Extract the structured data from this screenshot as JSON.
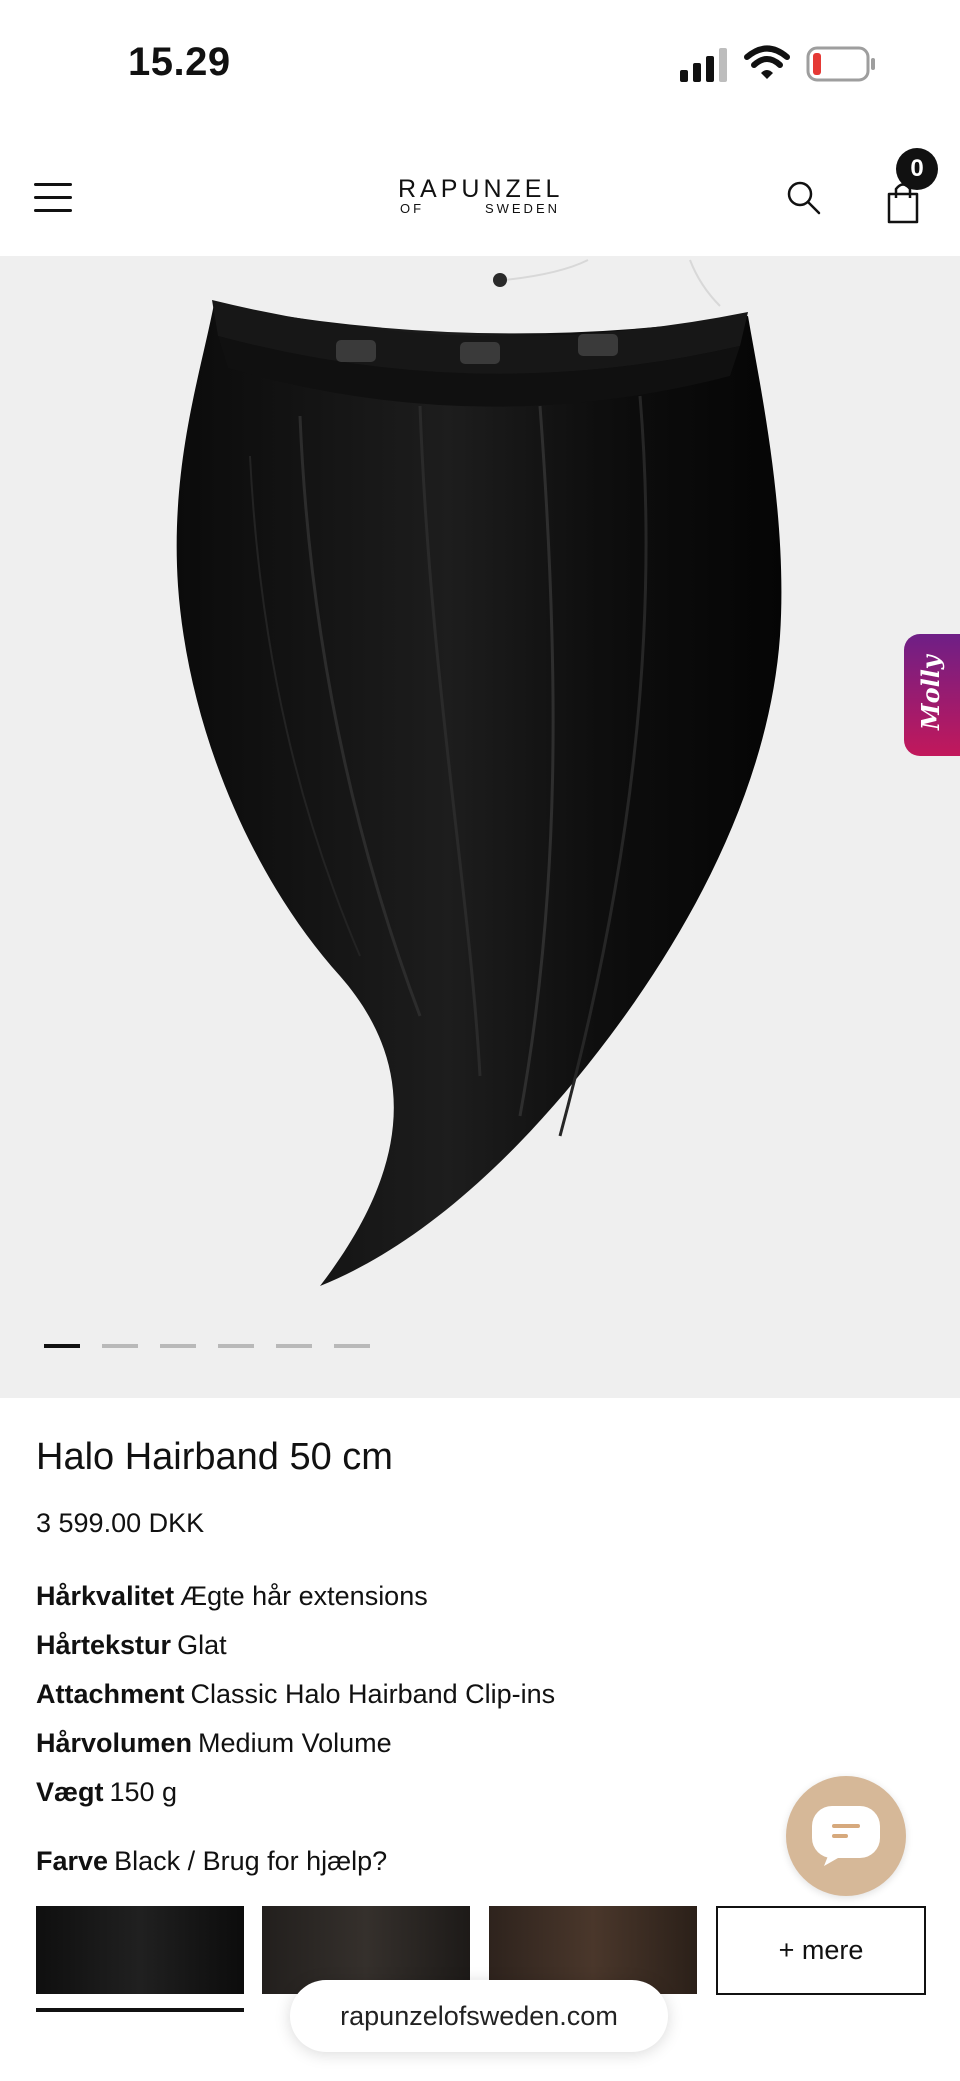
{
  "status_bar": {
    "time": "15.29",
    "signal_icon": "cellular-signal-icon",
    "wifi_icon": "wifi-icon",
    "battery_icon": "battery-low-icon",
    "battery_color": "#e53935"
  },
  "header": {
    "menu_icon": "hamburger-menu-icon",
    "logo": {
      "main": "RAPUNZEL",
      "sub_left": "OF",
      "sub_right": "SWEDEN"
    },
    "search_icon": "search-icon",
    "cart_icon": "shopping-bag-icon",
    "cart_count": "0"
  },
  "hero": {
    "image": "hair-extension-product-image",
    "background": "#efefef",
    "carousel_total": 6,
    "carousel_active": 1,
    "side_tab_label": "Molly",
    "side_tab_colors": [
      "#6e1f86",
      "#c2185b"
    ]
  },
  "product": {
    "title": "Halo Hairband 50 cm",
    "price": "3 599.00 DKK",
    "attributes": [
      {
        "label": "Hårkvalitet",
        "value": "Ægte hår extensions"
      },
      {
        "label": "Hårtekstur",
        "value": "Glat"
      },
      {
        "label": "Attachment",
        "value": "Classic Halo Hairband Clip-ins"
      },
      {
        "label": "Hårvolumen",
        "value": "Medium Volume"
      },
      {
        "label": "Vægt",
        "value": "150 g"
      }
    ],
    "color": {
      "label": "Farve",
      "value": "Black / Brug for hjælp?"
    },
    "swatches": [
      {
        "name": "black",
        "color": "#141414",
        "selected": true
      },
      {
        "name": "dark-brown",
        "color": "#2a2522",
        "selected": false
      },
      {
        "name": "brown",
        "color": "#3b2b22",
        "selected": false
      }
    ],
    "more_label": "+ mere"
  },
  "browser": {
    "url": "rapunzelofsweden.com"
  },
  "chat": {
    "icon": "chat-bubble-icon",
    "color": "#d6b898"
  }
}
